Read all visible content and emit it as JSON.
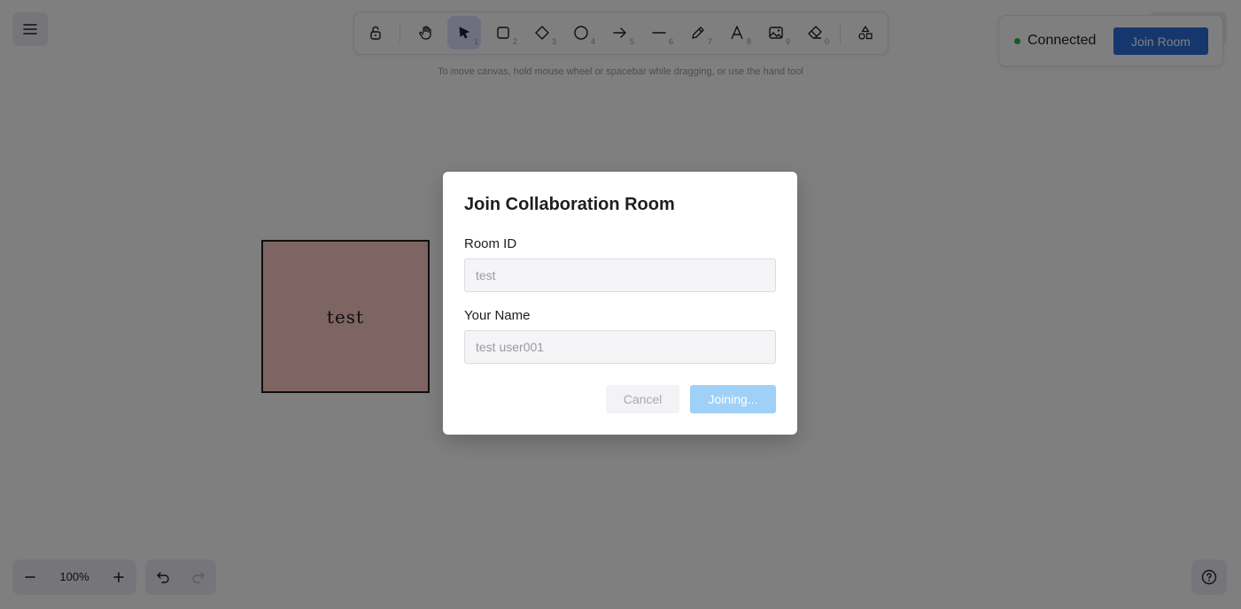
{
  "toolbar": {
    "tools": [
      {
        "icon": "lock-icon",
        "shortcut": ""
      },
      {
        "icon": "hand-icon",
        "shortcut": ""
      },
      {
        "icon": "pointer-icon",
        "shortcut": "1"
      },
      {
        "icon": "rectangle-icon",
        "shortcut": "2"
      },
      {
        "icon": "diamond-icon",
        "shortcut": "3"
      },
      {
        "icon": "ellipse-icon",
        "shortcut": "4"
      },
      {
        "icon": "arrow-icon",
        "shortcut": "5"
      },
      {
        "icon": "line-icon",
        "shortcut": "6"
      },
      {
        "icon": "pencil-icon",
        "shortcut": "7"
      },
      {
        "icon": "text-icon",
        "shortcut": "8"
      },
      {
        "icon": "image-icon",
        "shortcut": "9"
      },
      {
        "icon": "eraser-icon",
        "shortcut": "0"
      },
      {
        "icon": "shapes-library-icon",
        "shortcut": ""
      }
    ],
    "active_tool": "pointer-icon"
  },
  "hint": "To move canvas, hold mouse wheel or spacebar while dragging, or use the hand tool",
  "connection": {
    "status": "Connected",
    "status_color": "#2fb344",
    "join_label": "Join Room"
  },
  "canvas": {
    "shape_label": "test",
    "shape_fill": "#ffc9c9"
  },
  "zoom": {
    "level": "100%"
  },
  "dialog": {
    "title": "Join Collaboration Room",
    "room_id_label": "Room ID",
    "room_id_value": "test",
    "name_label": "Your Name",
    "name_value": "test user001",
    "cancel_label": "Cancel",
    "joining_label": "Joining..."
  },
  "colors": {
    "accent": "#2a6fdb",
    "active_tool_bg": "#e0dfff",
    "joining_disabled": "#9fd0f7"
  }
}
